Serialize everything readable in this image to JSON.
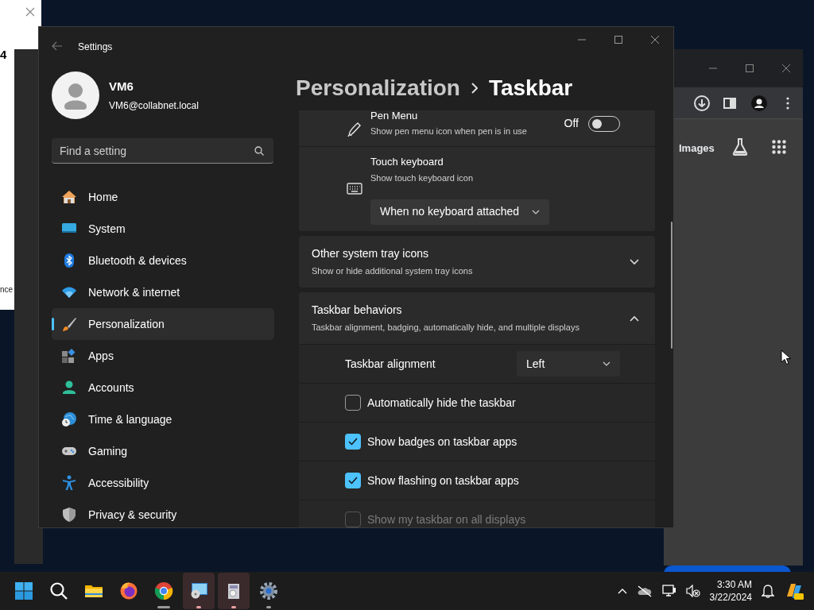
{
  "left_window": {
    "fragments": [
      "4",
      "nce"
    ]
  },
  "browser": {
    "link": "Images"
  },
  "settings": {
    "title": "Settings",
    "user": {
      "name": "VM6",
      "email": "VM6@collabnet.local"
    },
    "search": {
      "placeholder": "Find a setting"
    },
    "nav": [
      {
        "label": "Home",
        "selected": false
      },
      {
        "label": "System",
        "selected": false
      },
      {
        "label": "Bluetooth & devices",
        "selected": false
      },
      {
        "label": "Network & internet",
        "selected": false
      },
      {
        "label": "Personalization",
        "selected": true
      },
      {
        "label": "Apps",
        "selected": false
      },
      {
        "label": "Accounts",
        "selected": false
      },
      {
        "label": "Time & language",
        "selected": false
      },
      {
        "label": "Gaming",
        "selected": false
      },
      {
        "label": "Accessibility",
        "selected": false
      },
      {
        "label": "Privacy & security",
        "selected": false
      }
    ],
    "breadcrumb": [
      "Personalization",
      "Taskbar"
    ],
    "items": [
      {
        "kind": "toggle",
        "title": "Pen Menu",
        "description": "Show pen menu icon when pen is in use",
        "state_label": "Off",
        "on": false
      },
      {
        "kind": "dropdown_card",
        "title": "Touch keyboard",
        "description": "Show touch keyboard icon",
        "value": "When no keyboard attached"
      },
      {
        "kind": "expander",
        "title": "Other system tray icons",
        "description": "Show or hide additional system tray icons",
        "expanded": false
      },
      {
        "kind": "expander",
        "title": "Taskbar behaviors",
        "description": "Taskbar alignment, badging, automatically hide, and multiple displays",
        "expanded": true,
        "children": [
          {
            "kind": "select",
            "label": "Taskbar alignment",
            "value": "Left"
          },
          {
            "kind": "checkbox",
            "label": "Automatically hide the taskbar",
            "checked": false,
            "disabled": false
          },
          {
            "kind": "checkbox",
            "label": "Show badges on taskbar apps",
            "checked": true,
            "disabled": false
          },
          {
            "kind": "checkbox",
            "label": "Show flashing on taskbar apps",
            "checked": true,
            "disabled": false
          },
          {
            "kind": "checkbox",
            "label": "Show my taskbar on all displays",
            "checked": false,
            "disabled": true
          }
        ]
      }
    ]
  },
  "taskbar": {
    "apps": [
      {
        "active": false,
        "running": false,
        "focused": false
      },
      {
        "active": false,
        "running": false,
        "focused": false
      },
      {
        "active": false,
        "running": false,
        "focused": false
      },
      {
        "active": false,
        "running": false,
        "focused": false
      },
      {
        "active": false,
        "running": true,
        "focused": true
      },
      {
        "active": true,
        "running": true,
        "focused": false
      },
      {
        "active": true,
        "running": true,
        "focused": false
      },
      {
        "active": false,
        "running": true,
        "focused": false
      }
    ],
    "clock": {
      "time": "3:30 AM",
      "date": "3/22/2024"
    }
  }
}
